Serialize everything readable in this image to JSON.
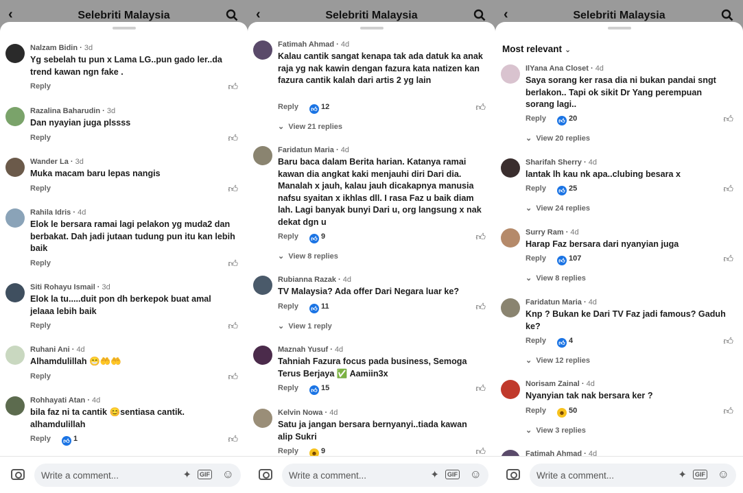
{
  "header": {
    "title": "Selebriti Malaysia"
  },
  "labels": {
    "reply": "Reply",
    "sort": "Most relevant",
    "composer_placeholder": "Write a comment...",
    "gif": "GIF"
  },
  "panels": [
    {
      "comments": [
        {
          "name": "Nalzam Bidin",
          "time": "3d",
          "text": "Yg sebelah tu pun x Lama LG..pun gado ler..da trend kawan ngn fake .",
          "reactions": null,
          "replies": null
        },
        {
          "name": "Razalina Baharudin",
          "time": "3d",
          "text": "Dan nyayian juga plssss",
          "reactions": null,
          "replies": null
        },
        {
          "name": "Wander La",
          "time": "3d",
          "text": "Muka macam baru lepas nangis",
          "reactions": null,
          "replies": null
        },
        {
          "name": "Rahila Idris",
          "time": "4d",
          "text": "Elok le bersara ramai lagi pelakon yg muda2 dan berbakat. Dah jadi jutaan tudung pun itu kan lebih baik",
          "reactions": null,
          "replies": null
        },
        {
          "name": "Siti Rohayu Ismail",
          "time": "3d",
          "text": "Elok la tu.....duit pon dh berkepok buat amal jelaaa lebih baik",
          "reactions": null,
          "replies": null
        },
        {
          "name": "Ruhani Ani",
          "time": "4d",
          "text": "Alhamdulillah 😁🤲🤲",
          "reactions": null,
          "replies": null
        },
        {
          "name": "Rohhayati Atan",
          "time": "4d",
          "text": "bila faz ni ta cantik 😊sentiasa cantik. alhamdulillah",
          "reactions": "1",
          "replies": null
        }
      ]
    },
    {
      "comments": [
        {
          "name": "Fatimah Ahmad",
          "time": "4d",
          "text": "Kalau cantik sangat kenapa tak ada datuk  ka anak raja yg nak kawin dengan fazura kata natizen kan fazura cantik kalah dari artis 2 yg lain",
          "reactions": "12",
          "replies": "View 21 replies"
        },
        {
          "name": "Faridatun Maria",
          "time": "4d",
          "text": "Baru baca dalam Berita harian. Katanya ramai kawan dia angkat kaki menjauhi diri Dari dia. Manalah x jauh, kalau jauh dicakapnya manusia nafsu syaitan x ikhlas dll. I rasa Faz u baik diam lah. Lagi banyak bunyi Dari u, org langsung x nak dekat dgn u",
          "reactions": "9",
          "replies": "View 8 replies"
        },
        {
          "name": "Rubianna Razak",
          "time": "4d",
          "text": "TV Malaysia? Ada offer Dari Negara luar ke?",
          "reactions": "11",
          "replies": "View 1 reply"
        },
        {
          "name": "Maznah Yusuf",
          "time": "4d",
          "text": "Tahniah Fazura focus pada business, Semoga Terus Berjaya ✅ Aamiin3x",
          "reactions": "15",
          "replies": null
        },
        {
          "name": "Kelvin Nowa",
          "time": "4d",
          "text": "Satu ja jangan bersara bernyanyi..tiada kawan alip Sukri",
          "reactions": "9",
          "reaction_type": "haha",
          "replies": null
        }
      ]
    },
    {
      "comments": [
        {
          "name": "IlYana Ana Closet",
          "time": "4d",
          "text": "Saya sorang ker rasa dia ni bukan pandai sngt berlakon.. Tapi ok sikit Dr Yang perempuan sorang lagi..",
          "reactions": "20",
          "replies": "View 20 replies"
        },
        {
          "name": "Sharifah Sherry",
          "time": "4d",
          "text": "lantak lh kau nk apa..clubing besara x",
          "reactions": "25",
          "replies": "View 24 replies"
        },
        {
          "name": "Surry Ram",
          "time": "4d",
          "text": "Harap Faz bersara dari nyanyian juga",
          "reactions": "107",
          "replies": "View 8 replies"
        },
        {
          "name": "Faridatun Maria",
          "time": "4d",
          "text": "Knp ? Bukan ke Dari TV Faz jadi famous? Gaduh ke?",
          "reactions": "4",
          "replies": "View 12 replies"
        },
        {
          "name": "Norisam Zainal",
          "time": "4d",
          "text": "Nyanyian tak nak bersara ker ?",
          "reactions": "50",
          "reaction_type": "haha",
          "replies": "View 3 replies"
        },
        {
          "name": "Fatimah Ahmad",
          "time": "4d",
          "text": "",
          "reactions": null,
          "replies": null
        }
      ]
    }
  ],
  "colors": {
    "like_blue": "#1b74e4",
    "haha_yellow": "#f7c21e"
  },
  "icons": [
    "back-arrow-icon",
    "search-icon",
    "like-thumb-icon",
    "camera-icon",
    "sparkle-sticker-icon",
    "gif-icon",
    "emoji-icon",
    "chevron-down-icon"
  ]
}
